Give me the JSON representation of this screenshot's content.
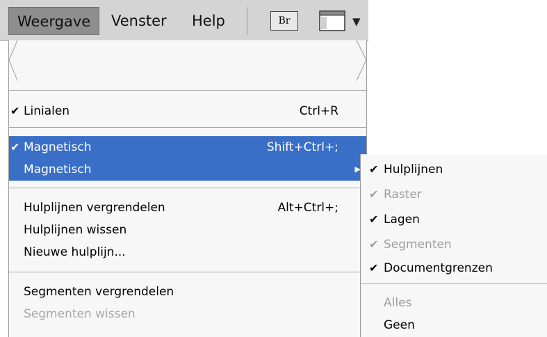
{
  "menubar": {
    "items": [
      {
        "label": "Weergave",
        "active": true
      },
      {
        "label": "Venster",
        "active": false
      },
      {
        "label": "Help",
        "active": false
      }
    ],
    "bridge_button_label": "Br",
    "workspace_icon": "workspace-layout-icon",
    "dropdown_icon": "triangle-down-icon"
  },
  "view_menu": {
    "items": [
      {
        "label": "Linialen",
        "shortcut": "Ctrl+R",
        "checked": true
      },
      {
        "label": "Magnetisch",
        "shortcut": "Shift+Ctrl+;",
        "checked": true,
        "highlighted": true
      },
      {
        "label": "Magnetisch",
        "has_submenu": true,
        "highlighted": true
      },
      {
        "label": "Hulplijnen vergrendelen",
        "shortcut": "Alt+Ctrl+;"
      },
      {
        "label": "Hulplijnen wissen"
      },
      {
        "label": "Nieuwe hulplijn..."
      },
      {
        "label": "Segmenten vergrendelen"
      },
      {
        "label": "Segmenten wissen",
        "disabled": true
      }
    ]
  },
  "snap_submenu": {
    "items": [
      {
        "label": "Hulplijnen",
        "checked": true
      },
      {
        "label": "Raster",
        "checked": true,
        "disabled": true
      },
      {
        "label": "Lagen",
        "checked": true
      },
      {
        "label": "Segmenten",
        "checked": true,
        "disabled": true
      },
      {
        "label": "Documentgrenzen",
        "checked": true
      },
      {
        "label": "Alles",
        "disabled": true
      },
      {
        "label": "Geen"
      }
    ]
  },
  "colors": {
    "highlight": "#3a6fc7",
    "menu_bg": "#f7f7f7",
    "menubar_bg": "#d4d4d4",
    "disabled_text": "#a8a8a8"
  },
  "glyphs": {
    "check": "✔",
    "submenu_arrow": "▶",
    "dropdown": "▼"
  }
}
